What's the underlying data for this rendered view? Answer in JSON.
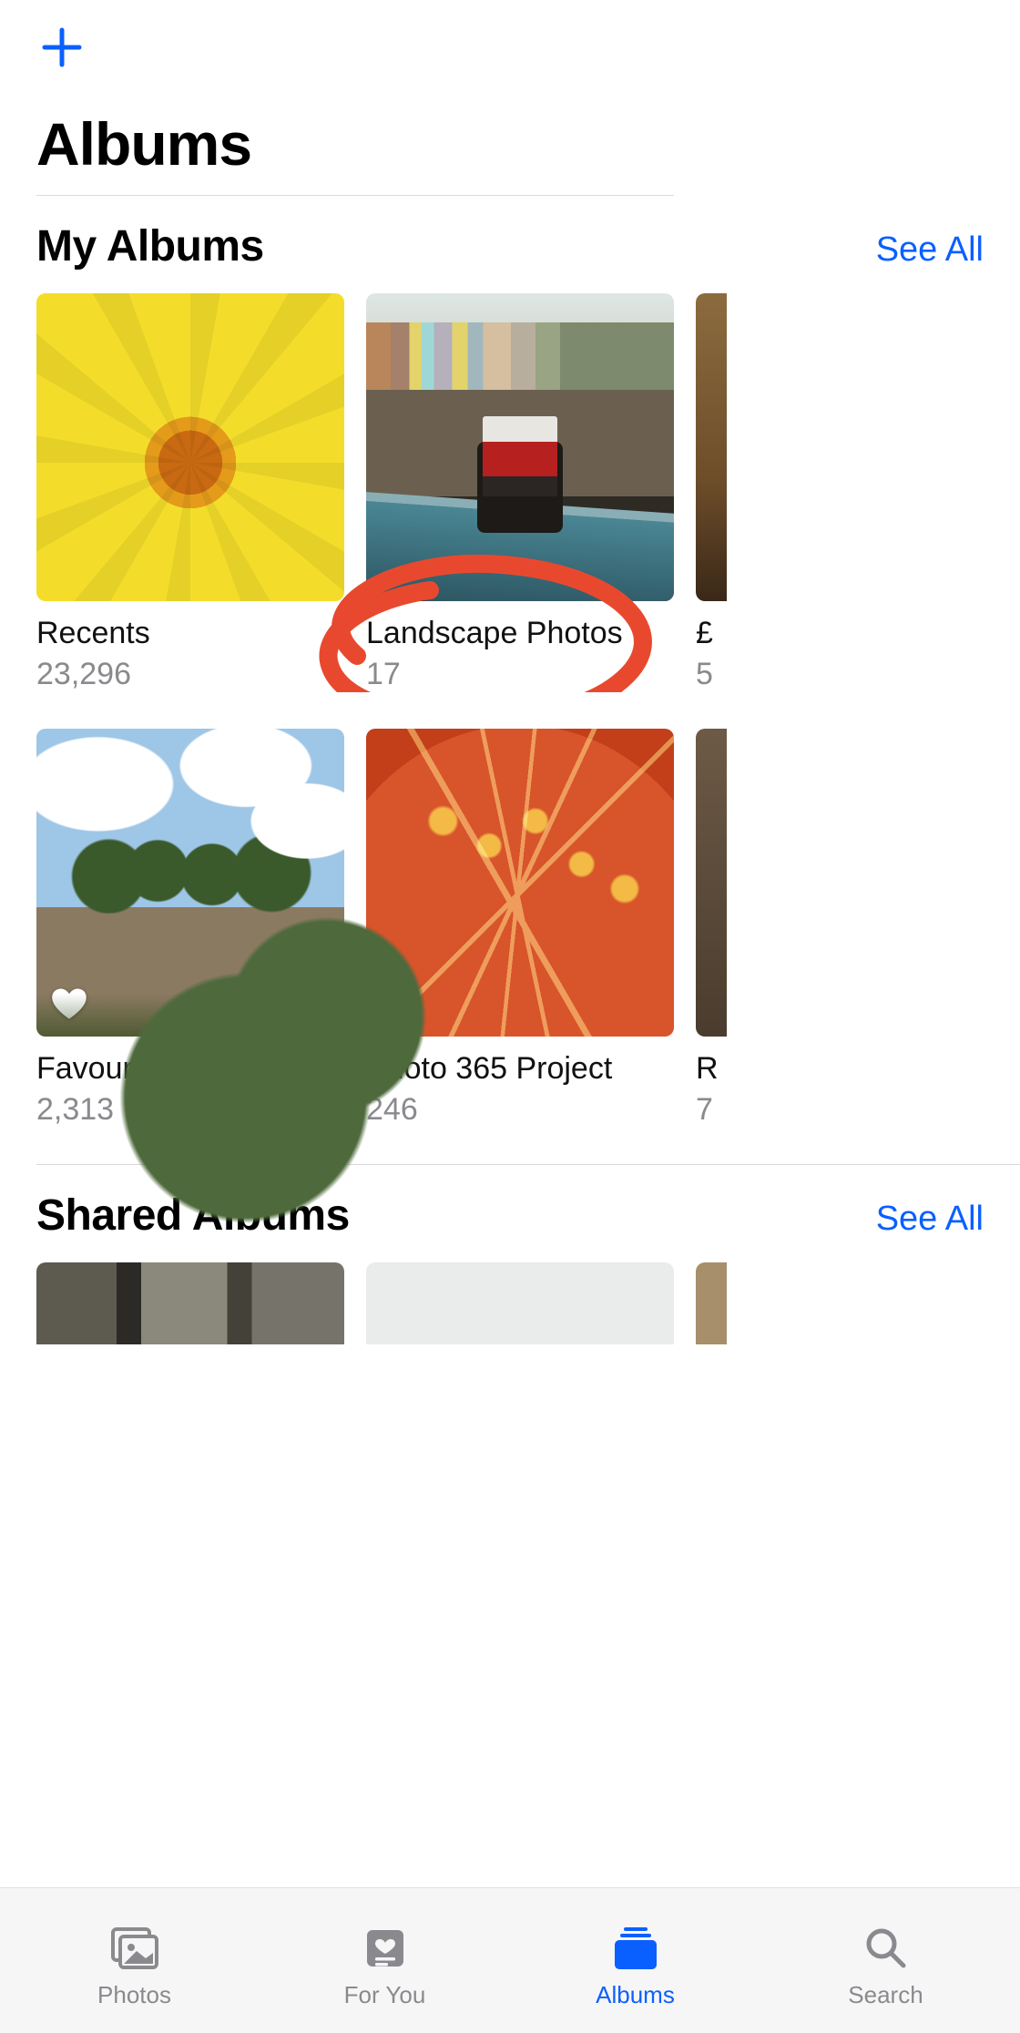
{
  "colors": {
    "accent": "#0a60ff",
    "muted": "#8a8a8e"
  },
  "header": {
    "title": "Albums"
  },
  "sections": {
    "myAlbums": {
      "title": "My Albums",
      "seeAll": "See All",
      "row1": [
        {
          "name": "Recents",
          "count": "23,296"
        },
        {
          "name": "Landscape Photos",
          "count": "17"
        },
        {
          "name_peek": "£",
          "count_peek": "5"
        }
      ],
      "row2": [
        {
          "name": "Favourites",
          "count": "2,313"
        },
        {
          "name": "Photo 365 Project",
          "count": "246"
        },
        {
          "name_peek": "R",
          "count_peek": "7"
        }
      ]
    },
    "sharedAlbums": {
      "title": "Shared Albums",
      "seeAll": "See All"
    }
  },
  "tabbar": {
    "photos": "Photos",
    "forYou": "For You",
    "albums": "Albums",
    "search": "Search",
    "active": "albums"
  },
  "annotation": {
    "target": "Landscape Photos"
  }
}
